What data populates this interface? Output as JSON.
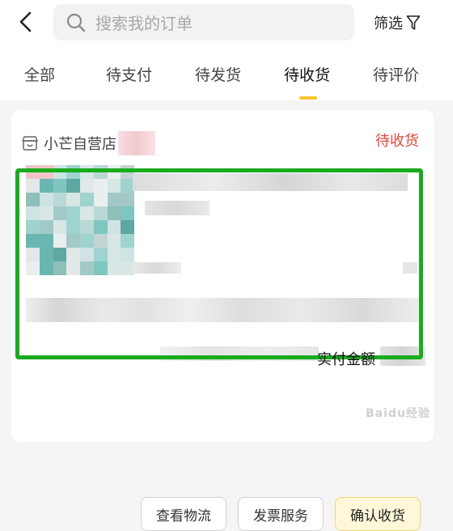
{
  "header": {
    "search_placeholder": "搜索我的订单",
    "filter_label": "筛选"
  },
  "tabs": [
    {
      "label": "全部"
    },
    {
      "label": "待支付"
    },
    {
      "label": "待发货"
    },
    {
      "label": "待收货",
      "active": true
    },
    {
      "label": "待评价"
    }
  ],
  "order": {
    "store_name": "小芒自营店",
    "status": "待收货",
    "amount_label": "实付金额",
    "actions": {
      "track": "查看物流",
      "invoice": "发票服务",
      "confirm": "确认收货"
    }
  },
  "watermark": "Baidu经验",
  "colors": {
    "accent": "#f7c52d",
    "status": "#e0473a",
    "highlight": "#1aab1f"
  }
}
